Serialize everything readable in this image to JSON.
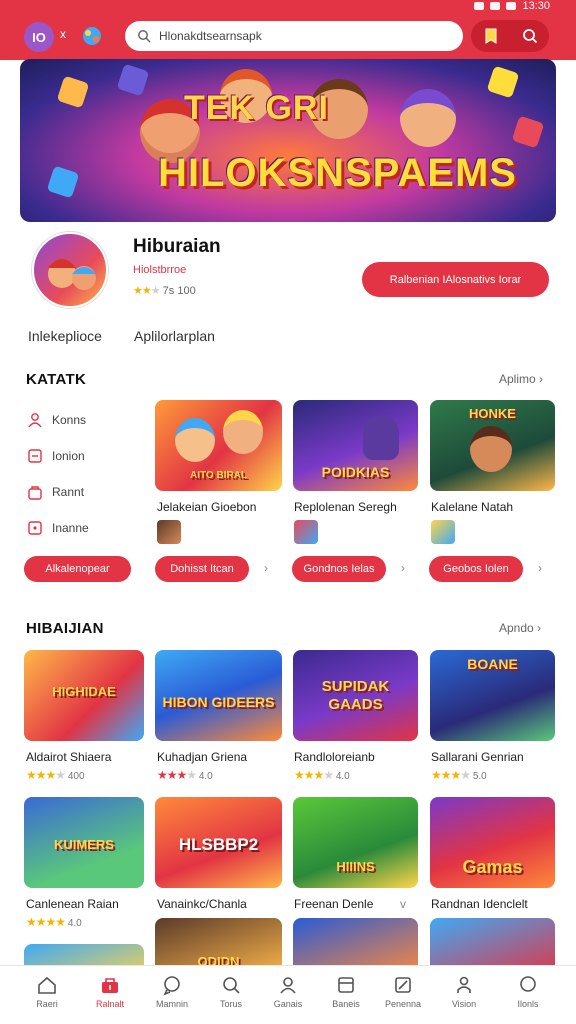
{
  "status_bar": {
    "time": "13:30"
  },
  "header": {
    "logo_text": "IO",
    "x_mark": "x",
    "search": {
      "value": "Hlonakdtsearnsapk"
    }
  },
  "banner": {
    "title_line1": "TEK GRI",
    "title_line2": "HILOKSNSPAEMS"
  },
  "profile": {
    "name": "Hiburaian",
    "subtitle": "Hiolstbrroe",
    "rating_text": "7s 100",
    "rating_stars": 2.5,
    "primary_button": "Ralbenian IAlosnativs Iorar",
    "tabs": [
      "Inlekeplioce",
      "Aplilorlarplan"
    ]
  },
  "section_katalk": {
    "title": "KATATK",
    "more": "Aplimo",
    "side_items": [
      {
        "label": "Konns",
        "icon": "person-icon"
      },
      {
        "label": "Ionion",
        "icon": "card-icon"
      },
      {
        "label": "Rannt",
        "icon": "bag-icon"
      },
      {
        "label": "Inanne",
        "icon": "note-icon"
      }
    ],
    "side_button": "Alkalenopear",
    "cards": [
      {
        "title": "Jelakeian Gioebon",
        "thumb_label": "AITO BIRAL",
        "button": "Dohisst Itcan"
      },
      {
        "title": "Replolenan Seregh",
        "thumb_label": "POIDKIAS",
        "button": "Gondnos Ielas"
      },
      {
        "title": "Kalelane Natah",
        "thumb_label": "HONKE",
        "button": "Geobos Iolen"
      }
    ]
  },
  "section_hiburan": {
    "title": "HIBAIJIAN",
    "more": "Apndo",
    "games": [
      {
        "title": "Aldairot Shiaera",
        "thumb_label": "HIGHIDAE",
        "stars": 3.5,
        "score": "400"
      },
      {
        "title": "Kuhadjan Griena",
        "thumb_label": "HIBON GIDEERS",
        "stars": 3.5,
        "score": "4.0"
      },
      {
        "title": "Randloloreianb",
        "thumb_label": "SUPIDAK GAADS",
        "stars": 3.5,
        "score": "4.0"
      },
      {
        "title": "Sallarani Genrian",
        "thumb_label": "BOANE",
        "stars": 3.5,
        "score": "5.0"
      },
      {
        "title": "Canlenean Raian",
        "thumb_label": "KUIMERS",
        "stars": 4,
        "score": "4.0"
      },
      {
        "title": "Vanainkc/Chanla",
        "thumb_label": "HLSBBP2",
        "stars": 0,
        "score": ""
      },
      {
        "title": "Freenan Denle",
        "thumb_label": "HIIINS",
        "stars": 0,
        "score": ""
      },
      {
        "title": "Randnan Idenclelt",
        "thumb_label": "Gamas",
        "stars": 0,
        "score": ""
      }
    ],
    "row3": [
      {
        "thumb_label": ""
      },
      {
        "thumb_label": "ODIDN"
      },
      {
        "thumb_label": ""
      },
      {
        "thumb_label": ""
      }
    ]
  },
  "bottom_nav": [
    {
      "label": "Raeri",
      "icon": "home-icon",
      "active": false
    },
    {
      "label": "Ralnalt",
      "icon": "store-icon",
      "active": true
    },
    {
      "label": "Mamnin",
      "icon": "chat-icon",
      "active": false
    },
    {
      "label": "Torus",
      "icon": "search-icon",
      "active": false
    },
    {
      "label": "Ganais",
      "icon": "user-icon",
      "active": false
    },
    {
      "label": "Baneis",
      "icon": "box-icon",
      "active": false
    },
    {
      "label": "Penenna",
      "icon": "edit-icon",
      "active": false
    },
    {
      "label": "Vision",
      "icon": "person-icon",
      "active": false
    },
    {
      "label": "Ilonls",
      "icon": "circle-icon",
      "active": false
    }
  ],
  "colors": {
    "brand": "#e23444",
    "brand_dark": "#c9202f",
    "star": "#f4b400"
  }
}
